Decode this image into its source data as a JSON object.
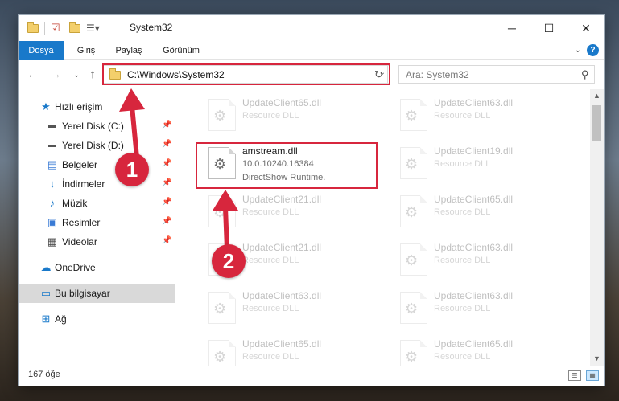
{
  "window": {
    "title": "System32",
    "controls": {
      "minimize": "─",
      "maximize": "☐",
      "close": "✕"
    }
  },
  "ribbon": {
    "tabs": [
      "Dosya",
      "Giriş",
      "Paylaş",
      "Görünüm"
    ],
    "help": "?"
  },
  "nav": {
    "back_icon": "arrow-left-icon",
    "forward_icon": "arrow-right-icon",
    "up_icon": "arrow-up-icon",
    "address": "C:\\Windows\\System32",
    "search_placeholder": "Ara: System32"
  },
  "sidebar": {
    "items": [
      {
        "label": "Hızlı erişim",
        "icon": "star-icon",
        "pinned": false
      },
      {
        "label": "Yerel Disk (C:)",
        "icon": "drive-icon",
        "pinned": true
      },
      {
        "label": "Yerel Disk (D:)",
        "icon": "drive-icon",
        "pinned": true
      },
      {
        "label": "Belgeler",
        "icon": "documents-icon",
        "pinned": true
      },
      {
        "label": "İndirmeler",
        "icon": "download-icon",
        "pinned": true
      },
      {
        "label": "Müzik",
        "icon": "music-icon",
        "pinned": true
      },
      {
        "label": "Resimler",
        "icon": "pictures-icon",
        "pinned": true
      },
      {
        "label": "Videolar",
        "icon": "video-icon",
        "pinned": true
      },
      {
        "label": "OneDrive",
        "icon": "cloud-icon",
        "pinned": false
      },
      {
        "label": "Bu bilgisayar",
        "icon": "computer-icon",
        "pinned": false,
        "selected": true
      },
      {
        "label": "Ağ",
        "icon": "network-icon",
        "pinned": false
      }
    ]
  },
  "files": [
    {
      "name": "UpdateClient65.dll",
      "line2": "Resource DLL",
      "line3": "",
      "highlighted": false
    },
    {
      "name": "UpdateClient63.dll",
      "line2": "Resource DLL",
      "line3": "",
      "highlighted": false
    },
    {
      "name": "amstream.dll",
      "line2": "10.0.10240.16384",
      "line3": "DirectShow Runtime.",
      "highlighted": true
    },
    {
      "name": "UpdateClient19.dll",
      "line2": "Resource DLL",
      "line3": "",
      "highlighted": false
    },
    {
      "name": "UpdateClient21.dll",
      "line2": "Resource DLL",
      "line3": "",
      "highlighted": false
    },
    {
      "name": "UpdateClient65.dll",
      "line2": "Resource DLL",
      "line3": "",
      "highlighted": false
    },
    {
      "name": "UpdateClient21.dll",
      "line2": "Resource DLL",
      "line3": "",
      "highlighted": false
    },
    {
      "name": "UpdateClient63.dll",
      "line2": "Resource DLL",
      "line3": "",
      "highlighted": false
    },
    {
      "name": "UpdateClient63.dll",
      "line2": "Resource DLL",
      "line3": "",
      "highlighted": false
    },
    {
      "name": "UpdateClient63.dll",
      "line2": "Resource DLL",
      "line3": "",
      "highlighted": false
    },
    {
      "name": "UpdateClient65.dll",
      "line2": "Resource DLL",
      "line3": "",
      "highlighted": false
    },
    {
      "name": "UpdateClient65.dll",
      "line2": "Resource DLL",
      "line3": "",
      "highlighted": false
    }
  ],
  "status": {
    "item_count": "167 öğe"
  },
  "annotations": {
    "step1": "1",
    "step2": "2",
    "color": "#d7263d"
  }
}
